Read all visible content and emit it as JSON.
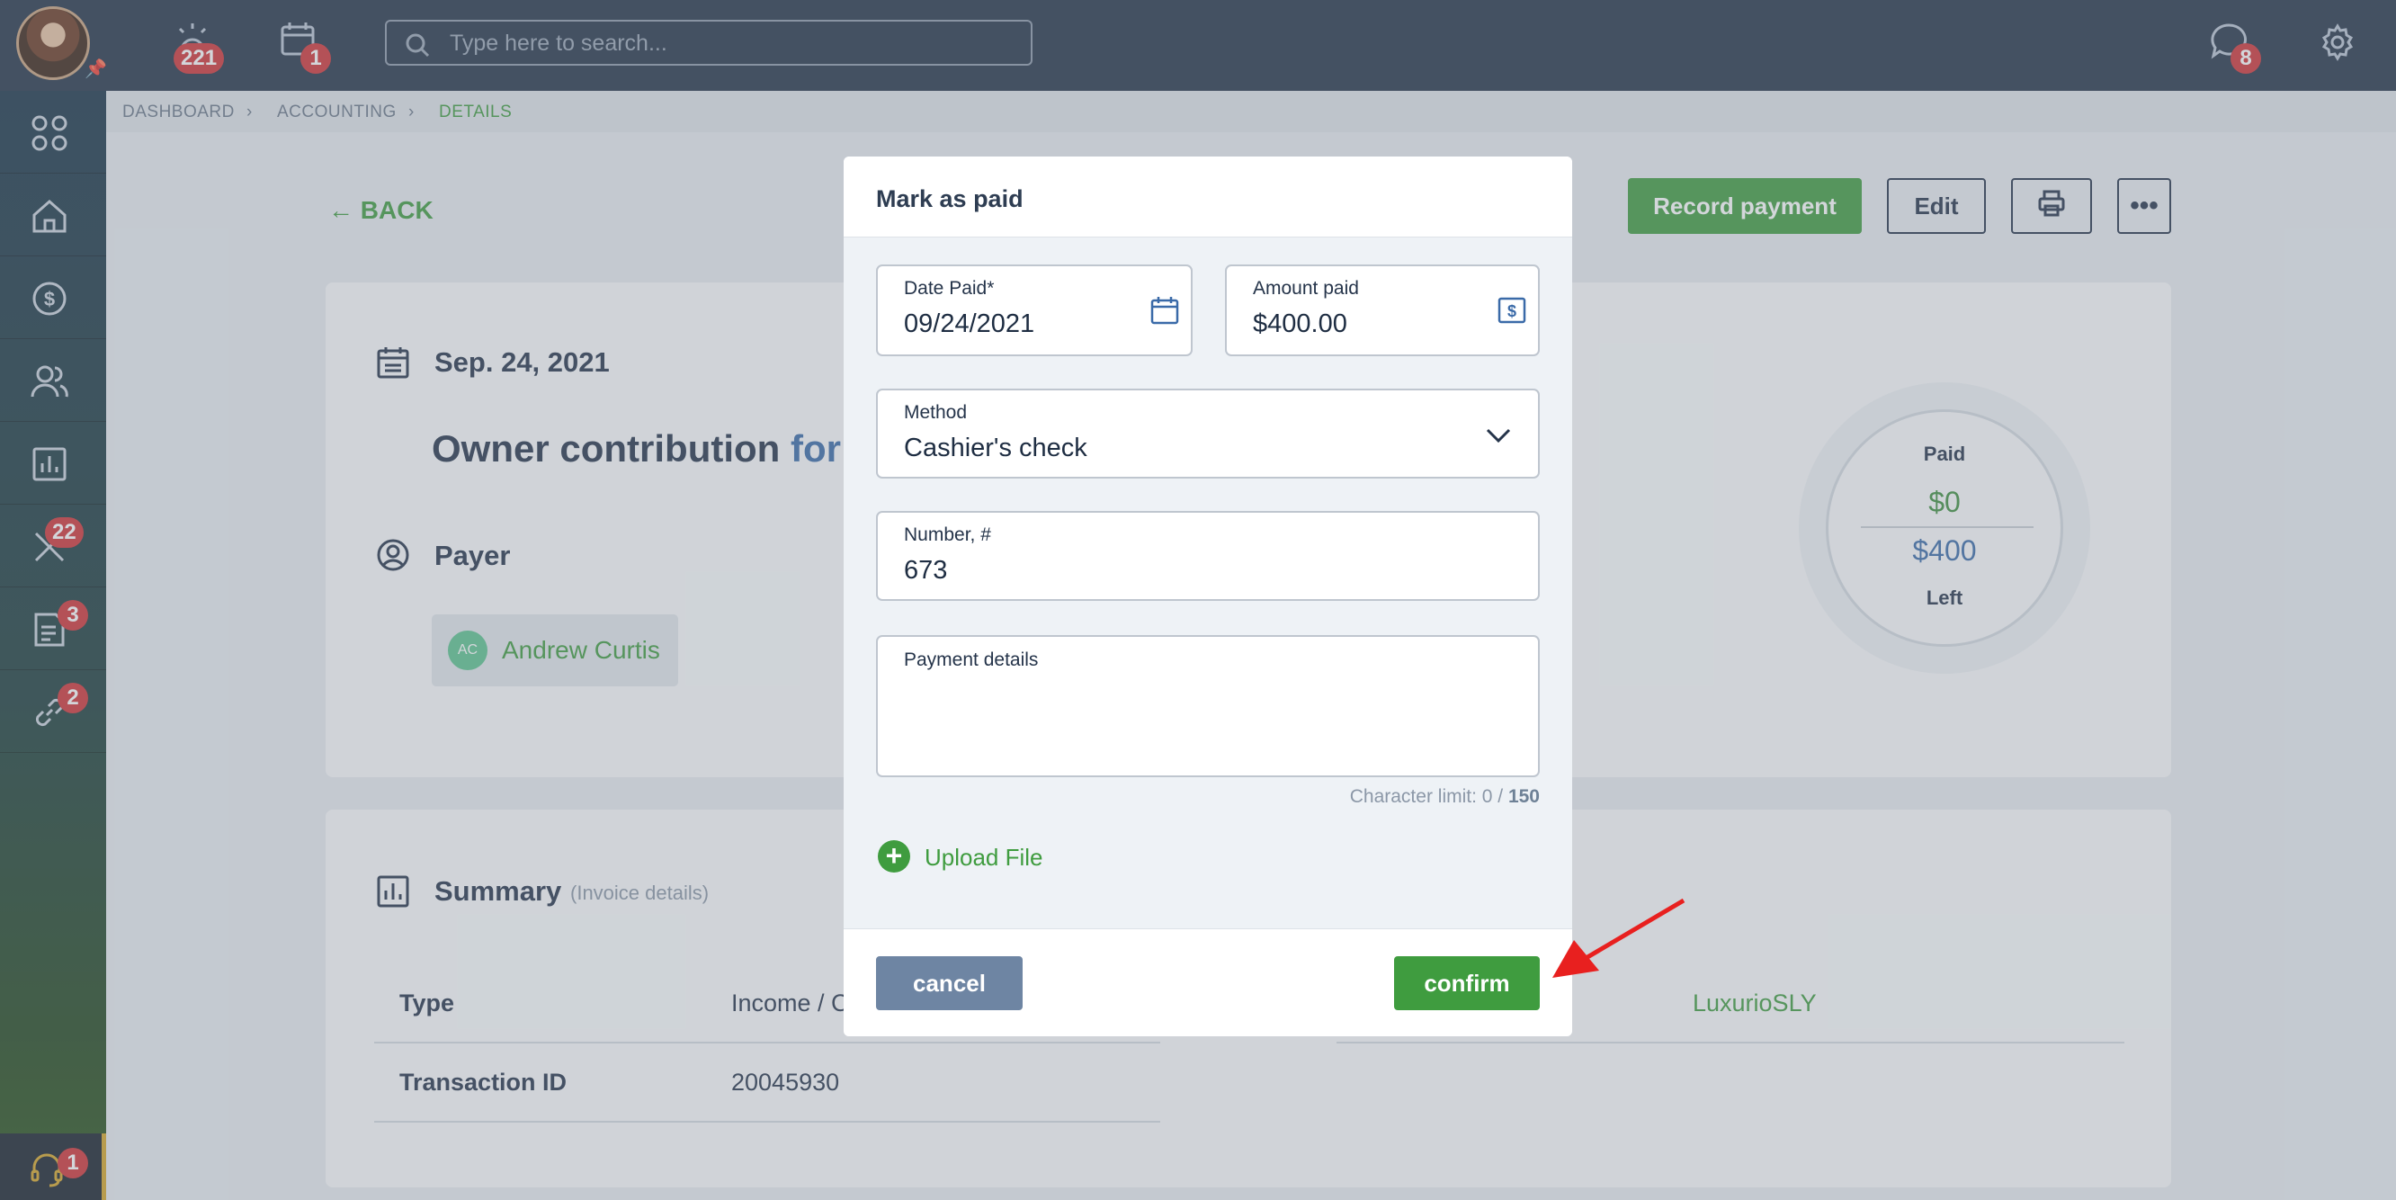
{
  "topbar": {
    "alarm_badge": "221",
    "calendar_badge": "1",
    "search_placeholder": "Type here to search...",
    "chat_badge": "8"
  },
  "sidebar": {
    "items": [
      {
        "icon": "apps-grid-icon",
        "badge": ""
      },
      {
        "icon": "home-icon",
        "badge": ""
      },
      {
        "icon": "dollar-icon",
        "badge": ""
      },
      {
        "icon": "people-icon",
        "badge": ""
      },
      {
        "icon": "chart-icon",
        "badge": ""
      },
      {
        "icon": "tools-icon",
        "badge": "22"
      },
      {
        "icon": "document-icon",
        "badge": "3"
      },
      {
        "icon": "link-icon",
        "badge": "2"
      }
    ],
    "support_badge": "1"
  },
  "breadcrumb": {
    "items": [
      "DASHBOARD",
      "ACCOUNTING",
      "DETAILS"
    ]
  },
  "page": {
    "back_label": "BACK",
    "record_payment": "Record payment",
    "edit": "Edit",
    "date": "Sep. 24, 2021",
    "title_main": "Owner contribution",
    "title_rest": "for",
    "payer_label": "Payer",
    "payer_initials": "AC",
    "payer_name": "Andrew Curtis",
    "paid_label": "Paid",
    "paid_value": "$0",
    "left_value": "$400",
    "left_label": "Left",
    "summary_title": "Summary",
    "summary_sub": "(Invoice details)",
    "rows": [
      {
        "label": "Type",
        "value": "Income / C"
      },
      {
        "label": "Transaction ID",
        "value": "20045930"
      }
    ],
    "right_value": "LuxurioSLY"
  },
  "modal": {
    "title": "Mark as paid",
    "date_label": "Date Paid*",
    "date_value": "09/24/2021",
    "amount_label": "Amount paid",
    "amount_value": "$400.00",
    "method_label": "Method",
    "method_value": "Cashier's check",
    "number_label": "Number, #",
    "number_value": "673",
    "details_label": "Payment details",
    "char_limit_prefix": "Character limit: 0 / ",
    "char_limit_max": "150",
    "upload_label": "Upload File",
    "cancel": "cancel",
    "confirm": "confirm"
  },
  "colors": {
    "accent_green": "#3f9c3f",
    "topbar": "#243448",
    "badge_red": "#cf3336",
    "cancel_blue": "#6e85a3",
    "arrow_red": "#e8201f"
  }
}
